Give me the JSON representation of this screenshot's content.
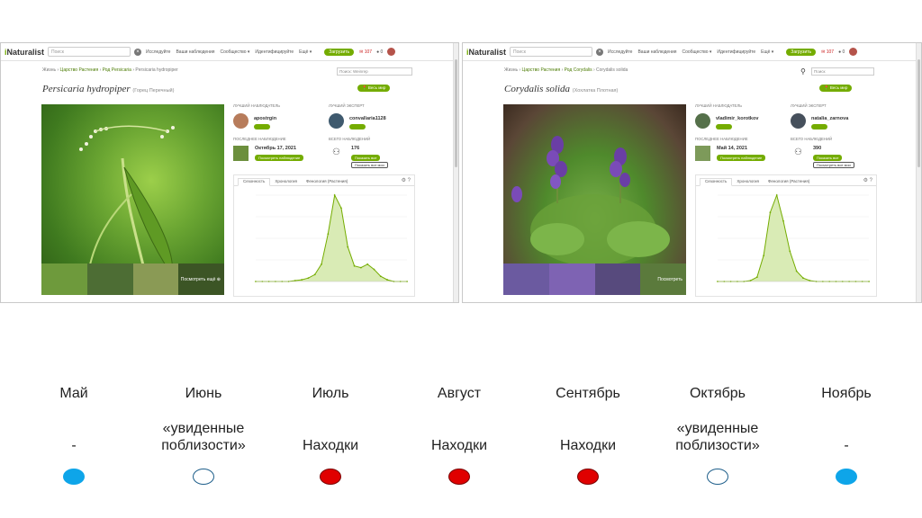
{
  "left_panel": {
    "logo": "iNaturalist",
    "search_placeholder": "Поиск",
    "nav": [
      "Исследуйте",
      "Ваши наблюдения",
      "Сообщество ▾",
      "Идентифицируйте",
      "Ещё ▾"
    ],
    "upload": "Загрузить",
    "mail_count": "107",
    "chat_count": "0",
    "breadcrumb": [
      "Жизнь",
      "Царство Растения",
      "Род Persicaria",
      "Persicaria hydropiper"
    ],
    "search_small": "Поиск: Weinrep",
    "place": "Весь мир",
    "species_name": "Persicaria hydropiper",
    "common_name": "(Горец Перечный)",
    "top_observer_label": "ЛУЧШИЙ НАБЛЮДАТЕЛЬ",
    "top_observer": "apostrgin",
    "top_identifier_label": "ЛУЧШИЙ ЭКСПЕРТ",
    "top_identifier": "convallaria1128",
    "latest_label": "ПОСЛЕДНЕЕ НАБЛЮДЕНИЕ",
    "latest_date": "Октябрь 17, 2021",
    "latest_btn": "Посмотреть наблюдение",
    "total_label": "ВСЕГО НАБЛЮДЕНИЙ",
    "total": "176",
    "total_btn": "Показать все",
    "total_btn2": "Показать все мои",
    "tabs": [
      "Сезонность",
      "Хронология",
      "Фенология (Растения)"
    ],
    "view_more": "Посмотреть ещё"
  },
  "right_panel": {
    "logo": "iNaturalist",
    "search_placeholder": "Поиск",
    "nav": [
      "Исследуйте",
      "Ваши наблюдения",
      "Сообщество ▾",
      "Идентифицируйте",
      "Ещё ▾"
    ],
    "upload": "Загрузить",
    "mail_count": "107",
    "chat_count": "0",
    "breadcrumb": [
      "Жизнь",
      "Царство Растения",
      "Род Corydalis",
      "Corydalis solida"
    ],
    "search_small": "Поиск",
    "place": "Весь мир",
    "species_name": "Corydalis solida",
    "common_name": "(Хохлатка Плотная)",
    "top_observer_label": "ЛУЧШИЙ НАБЛЮДАТЕЛЬ",
    "top_observer": "vladimir_korotkov",
    "top_identifier_label": "ЛУЧШИЙ ЭКСПЕРТ",
    "top_identifier": "natalia_zarnova",
    "latest_label": "ПОСЛЕДНЕЕ НАБЛЮДЕНИЕ",
    "latest_date": "Май 14, 2021",
    "latest_btn": "Посмотреть наблюдение",
    "total_label": "ВСЕГО НАБЛЮДЕНИЙ",
    "total": "390",
    "total_btn": "Показать все",
    "total_btn2": "Посмотреть все мои",
    "tabs": [
      "Сезонность",
      "Хронология",
      "Фенология (Растения)"
    ],
    "view_more": "Посмотреть"
  },
  "timeline": [
    {
      "month": "Май",
      "status": "-",
      "dot": "filled-blue"
    },
    {
      "month": "Июнь",
      "status": "«увиденные поблизости»",
      "dot": "outline-blue"
    },
    {
      "month": "Июль",
      "status": "Находки",
      "dot": "filled-red"
    },
    {
      "month": "Август",
      "status": "Находки",
      "dot": "filled-red"
    },
    {
      "month": "Сентябрь",
      "status": "Находки",
      "dot": "filled-red"
    },
    {
      "month": "Октябрь",
      "status": "«увиденные поблизости»",
      "dot": "outline-blue"
    },
    {
      "month": "Ноябрь",
      "status": "-",
      "dot": "filled-blue"
    }
  ],
  "colors": {
    "accent_green": "#74ac00",
    "dot_blue": "#0ea5e9",
    "dot_red": "#e00000",
    "outline_blue": "#1f5f8b"
  },
  "chart_data": [
    {
      "type": "area",
      "title": "",
      "series": [
        {
          "values": [
            0,
            0,
            0,
            0,
            0,
            0,
            1,
            2,
            4,
            8,
            20,
            55,
            100,
            85,
            40,
            18,
            16,
            20,
            14,
            6,
            2,
            0,
            0,
            0
          ]
        }
      ]
    },
    {
      "type": "area",
      "title": "",
      "series": [
        {
          "values": [
            0,
            0,
            0,
            0,
            0,
            1,
            5,
            30,
            80,
            100,
            70,
            35,
            12,
            4,
            1,
            0,
            0,
            0,
            0,
            0,
            0,
            0,
            0,
            0
          ]
        }
      ]
    }
  ]
}
